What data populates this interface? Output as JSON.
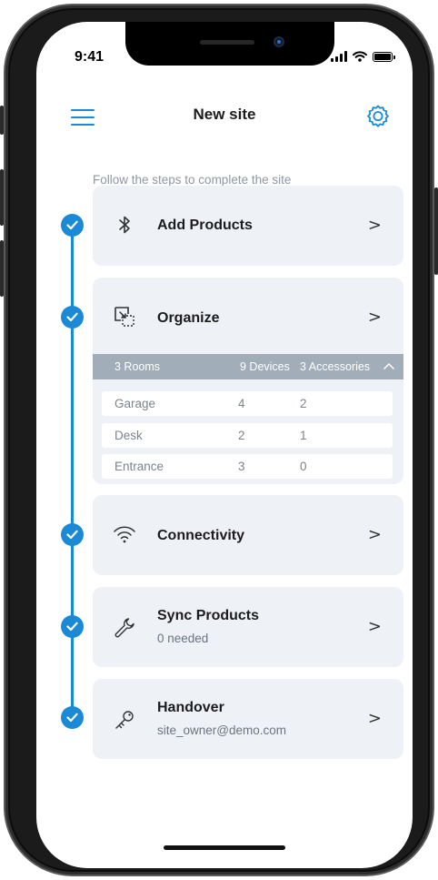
{
  "status": {
    "time": "9:41"
  },
  "header": {
    "title": "New site",
    "menu_icon": "hamburger-menu-icon",
    "settings_icon": "gear-icon"
  },
  "subtitle": "Follow the steps to complete the site",
  "accent_color": "#1a8ad6",
  "steps": [
    {
      "label": "Add Products",
      "icon": "bluetooth-icon",
      "chevron": ">"
    },
    {
      "label": "Organize",
      "icon": "organize-icon",
      "chevron": ">",
      "table": {
        "header": {
          "rooms": "3 Rooms",
          "devices": "9 Devices",
          "accessories": "3 Accessories"
        },
        "rows": [
          {
            "room": "Garage",
            "devices": "4",
            "accessories": "2"
          },
          {
            "room": "Desk",
            "devices": "2",
            "accessories": "1"
          },
          {
            "room": "Entrance",
            "devices": "3",
            "accessories": "0"
          }
        ]
      }
    },
    {
      "label": "Connectivity",
      "icon": "wifi-icon",
      "chevron": ">"
    },
    {
      "label": "Sync Products",
      "sub": "0 needed",
      "icon": "wrench-icon",
      "chevron": ">"
    },
    {
      "label": "Handover",
      "sub": "site_owner@demo.com",
      "icon": "key-icon",
      "chevron": ">"
    }
  ]
}
